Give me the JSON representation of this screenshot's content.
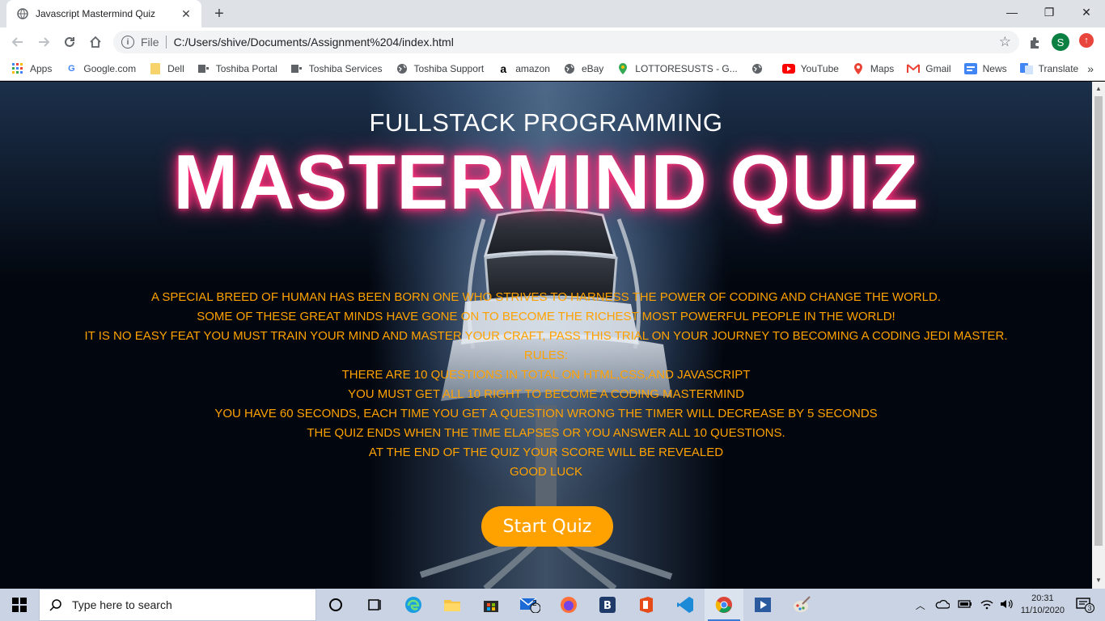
{
  "browser": {
    "tab_title": "Javascript Mastermind Quiz",
    "scheme_label": "File",
    "url": "C:/Users/shive/Documents/Assignment%204/index.html",
    "profile_initial": "S",
    "bookmarks": [
      {
        "label": "Apps",
        "icon": "apps-grid-icon"
      },
      {
        "label": "Google.com",
        "icon": "google-icon"
      },
      {
        "label": "Dell",
        "icon": "folder-icon"
      },
      {
        "label": "Toshiba Portal",
        "icon": "toshiba-icon"
      },
      {
        "label": "Toshiba Services",
        "icon": "toshiba-icon"
      },
      {
        "label": "Toshiba Support",
        "icon": "globe-icon"
      },
      {
        "label": "amazon",
        "icon": "amazon-icon"
      },
      {
        "label": "eBay",
        "icon": "globe-icon"
      },
      {
        "label": "LOTTORESUSTS - G...",
        "icon": "map-pin-icon"
      },
      {
        "label": "",
        "icon": "globe-icon"
      },
      {
        "label": "YouTube",
        "icon": "youtube-icon"
      },
      {
        "label": "Maps",
        "icon": "maps-icon"
      },
      {
        "label": "Gmail",
        "icon": "gmail-icon"
      },
      {
        "label": "News",
        "icon": "news-icon"
      },
      {
        "label": "Translate",
        "icon": "translate-icon"
      }
    ],
    "more_label": "»"
  },
  "page": {
    "subtitle": "FULLSTACK PROGRAMMING",
    "title": "MASTERMIND QUIZ",
    "intro_lines": [
      "A SPECIAL BREED OF HUMAN HAS BEEN BORN ONE WHO STRIVES TO HARNESS THE POWER OF CODING AND CHANGE THE WORLD.",
      "SOME OF THESE GREAT MINDS HAVE GONE ON TO BECOME THE RICHEST MOST POWERFUL PEOPLE IN THE WORLD!",
      "IT IS NO EASY FEAT YOU MUST TRAIN YOUR MIND AND MASTER YOUR CRAFT, PASS THIS TRIAL ON YOUR JOURNEY TO BECOMING A CODING JEDI MASTER.",
      "RULES:",
      "THERE ARE 10 QUESTIONS IN TOTAL ON HTML,CSS,AND JAVASCRIPT",
      "YOU MUST GET ALL 10 RIGHT TO BECOME A CODING MASTERMIND",
      "YOU HAVE 60 SECONDS, EACH TIME YOU GET A QUESTION WRONG THE TIMER WILL DECREASE BY 5 SECONDS",
      "THE QUIZ ENDS WHEN THE TIME ELAPSES OR YOU ANSWER ALL 10 QUESTIONS.",
      "AT THE END OF THE QUIZ YOUR SCORE WILL BE REVEALED",
      "GOOD LUCK"
    ],
    "start_button": "Start Quiz",
    "colors": {
      "accent": "#ffa200",
      "glow": "#ff2f7a",
      "title": "#ffffff"
    }
  },
  "taskbar": {
    "search_placeholder": "Type here to search",
    "mail_badge": "2",
    "time": "20:31",
    "date": "11/10/2020",
    "notification_count": "3"
  }
}
